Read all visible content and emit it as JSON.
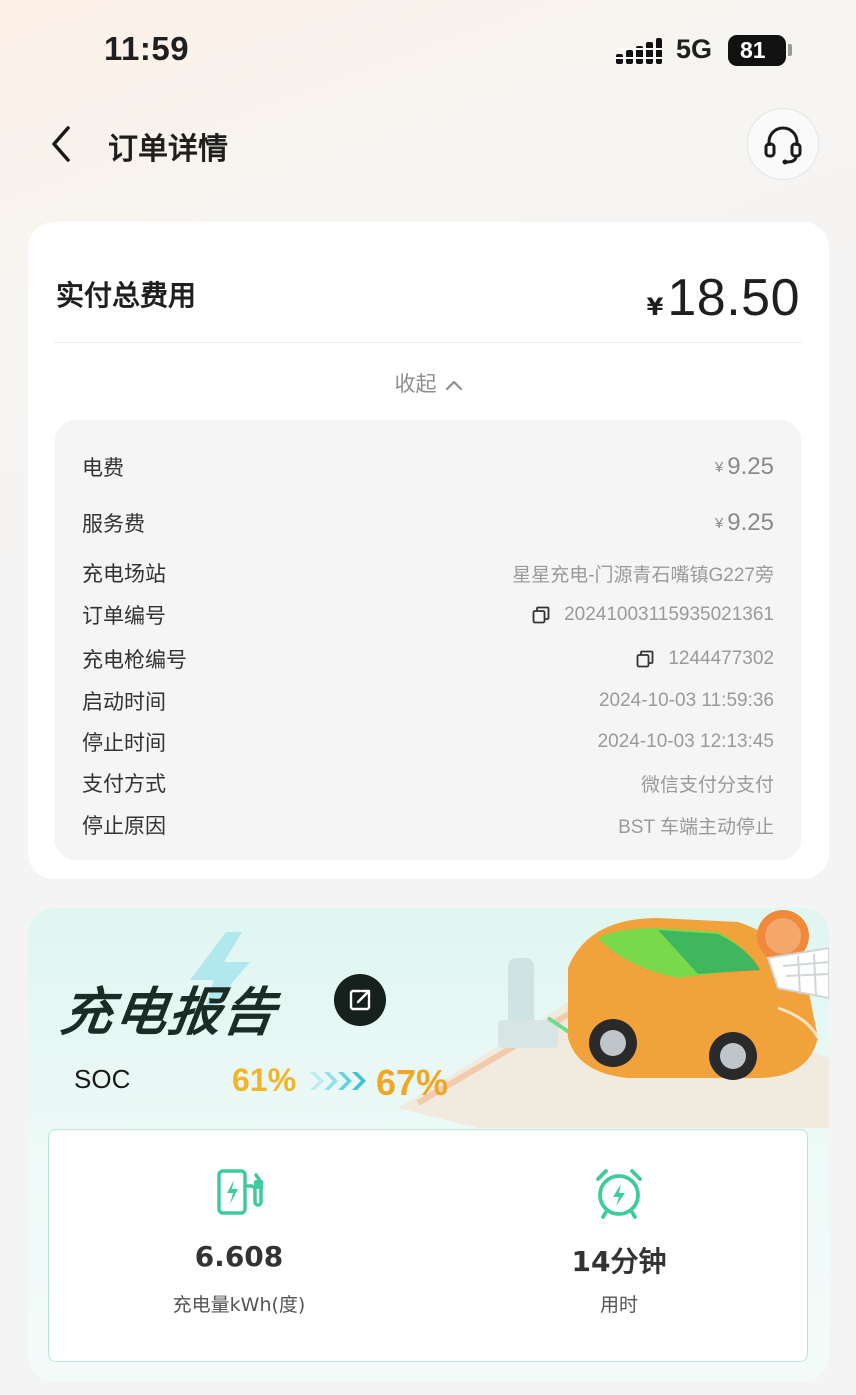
{
  "status_bar": {
    "time": "11:59",
    "network": "5G",
    "battery": "81"
  },
  "nav": {
    "title": "订单详情",
    "back_icon": "chevron-left-icon",
    "support_icon": "headset-icon"
  },
  "order": {
    "total_label": "实付总费用",
    "currency": "¥",
    "total_amount": "18.50",
    "collapse_label": "收起",
    "details": {
      "electricity_fee": {
        "label": "电费",
        "currency": "¥",
        "value": "9.25"
      },
      "service_fee": {
        "label": "服务费",
        "currency": "¥",
        "value": "9.25"
      },
      "station": {
        "label": "充电场站",
        "value": "星星充电-门源青石嘴镇G227旁"
      },
      "order_no": {
        "label": "订单编号",
        "value": "20241003115935021361"
      },
      "gun_no": {
        "label": "充电枪编号",
        "value": "1244477302"
      },
      "start_time": {
        "label": "启动时间",
        "value": "2024-10-03 11:59:36"
      },
      "stop_time": {
        "label": "停止时间",
        "value": "2024-10-03 12:13:45"
      },
      "payment": {
        "label": "支付方式",
        "value": "微信支付分支付"
      },
      "stop_reason": {
        "label": "停止原因",
        "value": "BST 车端主动停止"
      }
    }
  },
  "report": {
    "title": "充电报告",
    "soc_label": "SOC",
    "soc_from": "61%",
    "soc_to": "67%",
    "energy": {
      "value": "6.608",
      "caption": "充电量kWh(度)"
    },
    "duration": {
      "value": "14分钟",
      "caption": "用时"
    },
    "colors": {
      "accent": "#3ecb9e",
      "soc": "#f0b52a"
    }
  }
}
